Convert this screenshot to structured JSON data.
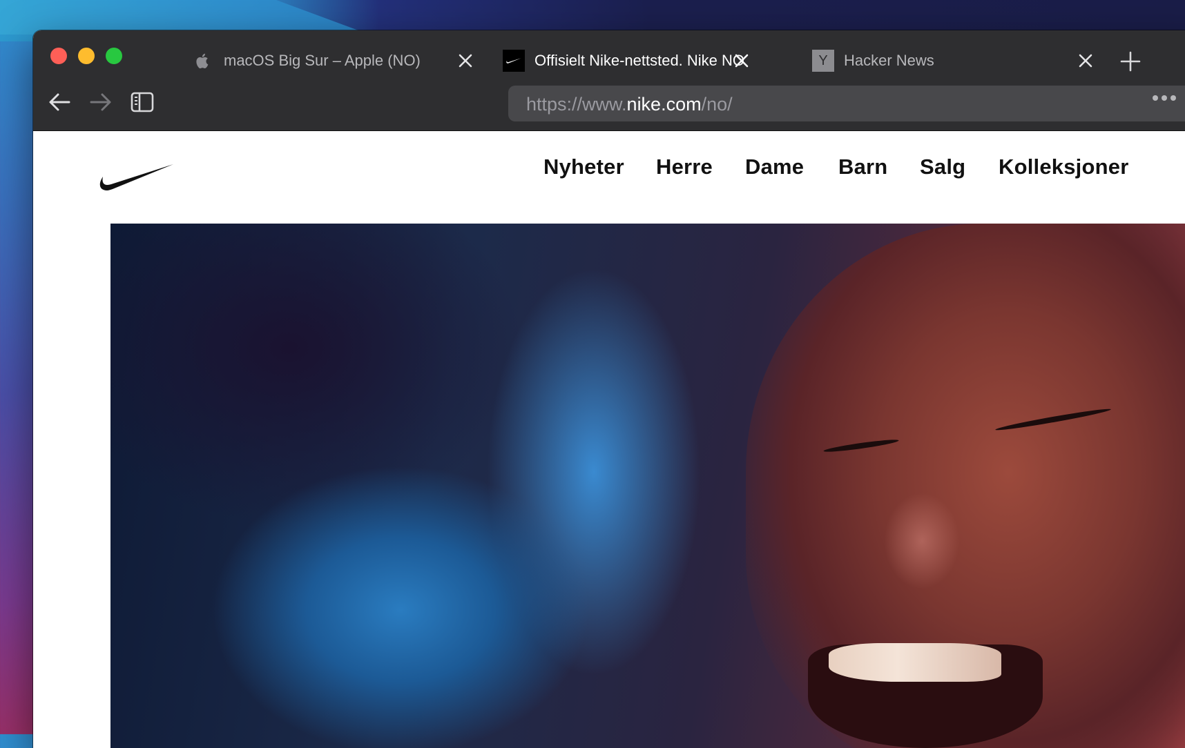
{
  "browser": {
    "tabs": [
      {
        "title": "macOS Big Sur – Apple (NO)",
        "favicon": "apple-icon",
        "active": false
      },
      {
        "title": "Offisielt Nike-nettsted. Nike NO",
        "favicon": "nike-swoosh-icon",
        "active": true
      },
      {
        "title": "Hacker News",
        "favicon": "hacker-news-icon",
        "favicon_text": "Y",
        "active": false
      }
    ],
    "url": {
      "scheme": "https://www.",
      "host": "nike.com",
      "path": "/no/"
    }
  },
  "site": {
    "logo": "nike-swoosh-icon",
    "nav": [
      "Nyheter",
      "Herre",
      "Dame",
      "Barn",
      "Salg",
      "Kolleksjoner"
    ]
  },
  "colors": {
    "toolbar": "#2e2e30",
    "urlbar": "#48484b",
    "traffic_red": "#fe5f57",
    "traffic_yellow": "#febc2e",
    "traffic_green": "#28c840"
  }
}
